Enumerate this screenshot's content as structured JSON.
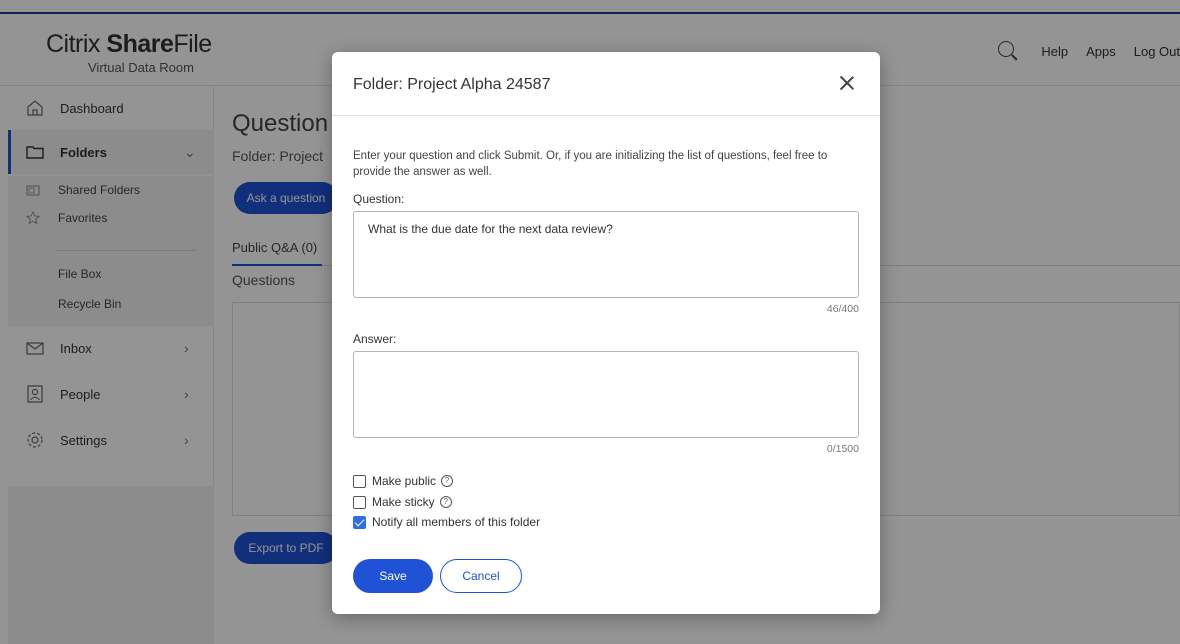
{
  "header": {
    "logo_light": "Citrix ",
    "logo_bold": "Share",
    "logo_light2": "File",
    "logo_sub": "Virtual Data Room",
    "links": [
      "Help",
      "Apps",
      "Log Out"
    ]
  },
  "sidebar": {
    "dashboard": "Dashboard",
    "folders": "Folders",
    "shared_folders": "Shared Folders",
    "favorites": "Favorites",
    "file_box": "File Box",
    "recycle_bin": "Recycle Bin",
    "inbox": "Inbox",
    "people": "People",
    "settings": "Settings"
  },
  "main": {
    "title": "Question",
    "subtitle": "Folder: Project",
    "ask_button": "Ask a question",
    "tab_public": "Public Q&A (0)",
    "questions_heading": "Questions",
    "export_button": "Export to PDF"
  },
  "modal": {
    "title": "Folder: Project Alpha 24587",
    "intro": "Enter your question and click Submit. Or, if you are initializing the list of questions, feel free to provide the answer as well.",
    "question_label": "Question:",
    "question_value": "What is the due date for the next data review?",
    "question_counter": "46/400",
    "answer_label": "Answer:",
    "answer_value": "",
    "answer_counter": "0/1500",
    "make_public": "Make public",
    "make_sticky": "Make sticky",
    "notify_members": "Notify all members of this folder",
    "save": "Save",
    "cancel": "Cancel"
  },
  "colors": {
    "accent": "#1f52d6",
    "header_line": "#1f3a8f"
  }
}
